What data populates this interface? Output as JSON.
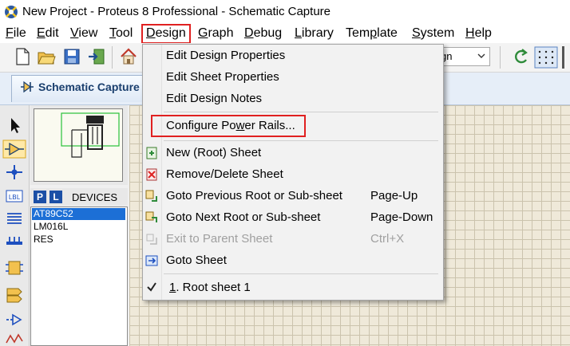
{
  "window": {
    "title": "New Project - Proteus 8 Professional - Schematic Capture",
    "colors": {
      "highlight": "#e02020",
      "selection": "#1c6fd6",
      "device_buttons": "#1b4fa6"
    }
  },
  "menubar": {
    "items": [
      {
        "label": "File",
        "mnemonic": "F",
        "rest": "ile"
      },
      {
        "label": "Edit",
        "mnemonic": "E",
        "rest": "dit"
      },
      {
        "label": "View",
        "mnemonic": "V",
        "rest": "iew"
      },
      {
        "label": "Tool",
        "mnemonic": "T",
        "rest": "ool"
      },
      {
        "label": "Design",
        "mnemonic": "D",
        "rest": "esign"
      },
      {
        "label": "Graph",
        "mnemonic": "G",
        "rest": "raph"
      },
      {
        "label": "Debug",
        "mnemonic": "D",
        "rest": "ebug"
      },
      {
        "label": "Library",
        "mnemonic": "L",
        "rest": "ibrary"
      },
      {
        "label": "Template",
        "pre": "Tem",
        "mnemonic": "p",
        "rest": "late"
      },
      {
        "label": "System",
        "mnemonic": "S",
        "rest": "ystem"
      },
      {
        "label": "Help",
        "mnemonic": "H",
        "rest": "elp"
      }
    ]
  },
  "toolbar": {
    "zoom_value": "gn",
    "icons": [
      "new-file-icon",
      "open-folder-icon",
      "save-icon",
      "import-icon",
      "home-icon",
      "refresh-icon",
      "grid-icon"
    ]
  },
  "tabs": [
    {
      "label": "Schematic Capture"
    }
  ],
  "devices": {
    "header": "DEVICES",
    "p_button": "P",
    "l_button": "L",
    "items": [
      "AT89C52",
      "LM016L",
      "RES"
    ],
    "selected": "AT89C52"
  },
  "design_menu": {
    "items": [
      {
        "label": "Edit Design Properties",
        "shortcut": "",
        "enabled": true
      },
      {
        "label": "Edit Sheet Properties",
        "shortcut": "",
        "enabled": true
      },
      {
        "label": "Edit Design Notes",
        "shortcut": "",
        "enabled": true
      },
      {
        "label": "Configure Power Rails...",
        "pre": "Configure Po",
        "mnemonic": "w",
        "rest": "er Rails...",
        "shortcut": "",
        "enabled": true
      },
      {
        "label": "New (Root) Sheet",
        "shortcut": "",
        "enabled": true
      },
      {
        "label": "Remove/Delete Sheet",
        "shortcut": "",
        "enabled": true
      },
      {
        "label": "Goto Previous Root or Sub-sheet",
        "shortcut": "Page-Up",
        "enabled": true
      },
      {
        "label": "Goto Next Root or Sub-sheet",
        "shortcut": "Page-Down",
        "enabled": true
      },
      {
        "label": "Exit to Parent Sheet",
        "shortcut": "Ctrl+X",
        "enabled": false
      },
      {
        "label": "Goto Sheet",
        "shortcut": "",
        "enabled": true
      },
      {
        "label": "1. Root sheet 1",
        "mnemonic": "1",
        "rest": ". Root sheet 1",
        "shortcut": "",
        "enabled": true,
        "checked": true
      }
    ]
  }
}
